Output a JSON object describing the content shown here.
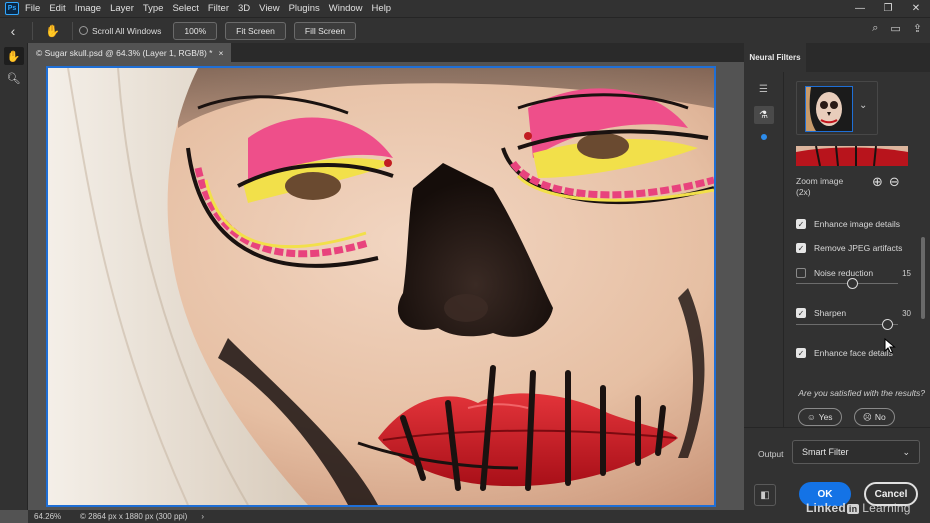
{
  "menubar": {
    "app_logo": "Ps",
    "items": [
      "File",
      "Edit",
      "Image",
      "Layer",
      "Type",
      "Select",
      "Filter",
      "3D",
      "View",
      "Plugins",
      "Window",
      "Help"
    ]
  },
  "options_bar": {
    "scroll_all_windows": "Scroll All Windows",
    "zoom_100": "100%",
    "fit_screen": "Fit Screen",
    "fill_screen": "Fill Screen"
  },
  "document": {
    "tab_title": "© Sugar skull.psd @ 64.3% (Layer 1, RGB/8) *",
    "close": "×"
  },
  "status": {
    "zoom": "64.26%",
    "info": "2864 px x 1880 px (300 ppi)",
    "more": "›"
  },
  "panel": {
    "tab": "Neural Filters",
    "zoom_label": "Zoom image (2x)",
    "options": [
      {
        "label": "Enhance image details",
        "checked": true
      },
      {
        "label": "Remove JPEG artifacts",
        "checked": true
      },
      {
        "label": "Noise reduction",
        "checked": false,
        "value": "15"
      },
      {
        "label": "Sharpen",
        "checked": true,
        "value": "30"
      },
      {
        "label": "Enhance face details",
        "checked": true
      }
    ],
    "noise_level": 15,
    "sharpen_level": 30,
    "satisfied": "Are you satisfied with the results?",
    "yes": "Yes",
    "no": "No",
    "output_label": "Output",
    "output_value": "Smart Filter",
    "ok": "OK",
    "cancel": "Cancel"
  },
  "watermark": {
    "linked": "Linked",
    "in": "in",
    "learning": "Learning"
  },
  "colors": {
    "accent": "#1473e6",
    "frame": "#1f6fd6",
    "chrome": "#323232"
  }
}
